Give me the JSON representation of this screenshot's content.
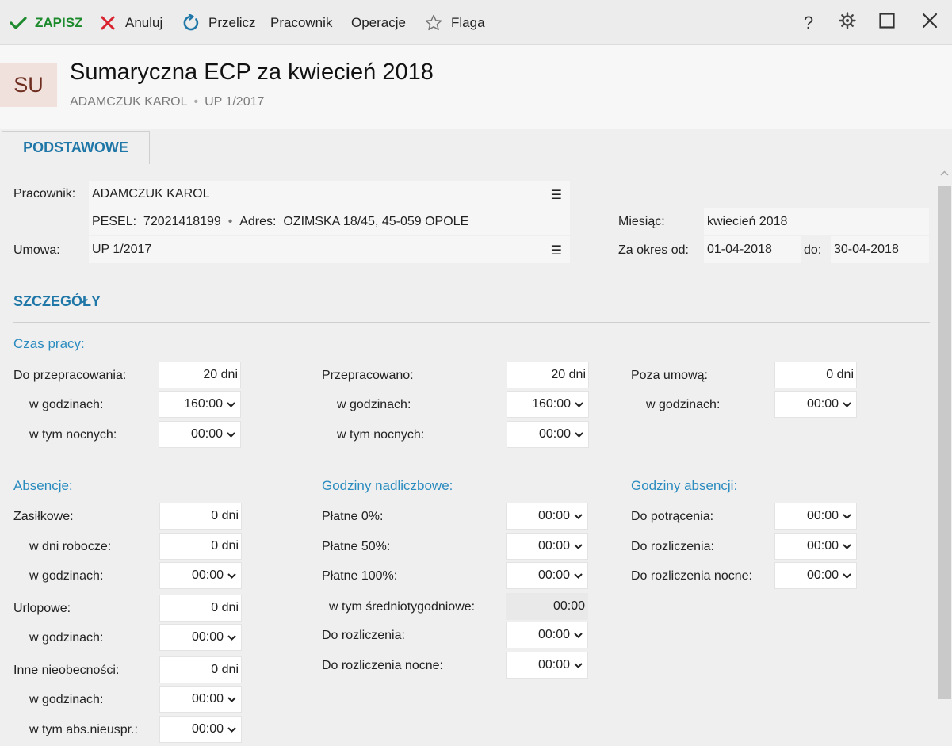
{
  "toolbar": {
    "save": "ZAPISZ",
    "cancel": "Anuluj",
    "recalc": "Przelicz",
    "employee": "Pracownik",
    "operations": "Operacje",
    "flag": "Flaga",
    "help": "?"
  },
  "colors": {
    "save_green": "#1e8a2e",
    "cancel_red": "#d9232e",
    "accent_blue": "#1f77a8",
    "avatar_bg": "#f0e1dc"
  },
  "header": {
    "avatar": "SU",
    "title": "Sumaryczna ECP za kwiecień 2018",
    "subtitle_name": "ADAMCZUK KAROL",
    "subtitle_contract": "UP 1/2017"
  },
  "tabs": {
    "active": "PODSTAWOWE"
  },
  "basic": {
    "employee_label": "Pracownik:",
    "employee_value": "ADAMCZUK KAROL",
    "pesel_label": "PESEL:",
    "pesel_value": "72021418199",
    "address_label": "Adres:",
    "address_value": "OZIMSKA 18/45, 45-059 OPOLE",
    "contract_label": "Umowa:",
    "contract_value": "UP 1/2017",
    "month_label": "Miesiąc:",
    "month_value": "kwiecień 2018",
    "period_label": "Za okres od:",
    "period_from": "01-04-2018",
    "period_to_label": "do:",
    "period_to": "30-04-2018"
  },
  "details": {
    "title": "SZCZEGÓŁY",
    "work_time": {
      "title": "Czas pracy:",
      "to_work_label": "Do przepracowania:",
      "to_work_days": "20 dni",
      "to_work_hours_label": "w godzinach:",
      "to_work_hours": "160:00",
      "to_work_night_label": "w tym nocnych:",
      "to_work_night": "00:00",
      "worked_label": "Przepracowano:",
      "worked_days": "20 dni",
      "worked_hours_label": "w godzinach:",
      "worked_hours": "160:00",
      "worked_night_label": "w tym nocnych:",
      "worked_night": "00:00",
      "outside_label": "Poza umową:",
      "outside_days": "0 dni",
      "outside_hours_label": "w godzinach:",
      "outside_hours": "00:00"
    },
    "absences": {
      "title": "Absencje:",
      "sick_label": "Zasiłkowe:",
      "sick_days": "0 dni",
      "sick_workdays_label": "w dni robocze:",
      "sick_workdays": "0 dni",
      "sick_hours_label": "w godzinach:",
      "sick_hours": "00:00",
      "leave_label": "Urlopowe:",
      "leave_days": "0 dni",
      "leave_hours_label": "w godzinach:",
      "leave_hours": "00:00",
      "other_label": "Inne nieobecności:",
      "other_days": "0 dni",
      "other_hours_label": "w godzinach:",
      "other_hours": "00:00",
      "unexcused_label": "w tym abs.nieuspr.:",
      "unexcused": "00:00"
    },
    "overtime": {
      "title": "Godziny nadliczbowe:",
      "paid0_label": "Płatne 0%:",
      "paid0": "00:00",
      "paid50_label": "Płatne 50%:",
      "paid50": "00:00",
      "paid100_label": "Płatne 100%:",
      "paid100": "00:00",
      "weekly_label": "w tym średniotygodniowe:",
      "weekly": "00:00",
      "settle_label": "Do rozliczenia:",
      "settle": "00:00",
      "settle_night_label": "Do rozliczenia nocne:",
      "settle_night": "00:00"
    },
    "absence_hours": {
      "title": "Godziny absencji:",
      "deduct_label": "Do potrącenia:",
      "deduct": "00:00",
      "settle_label": "Do rozliczenia:",
      "settle": "00:00",
      "settle_night_label": "Do rozliczenia nocne:",
      "settle_night": "00:00"
    }
  }
}
